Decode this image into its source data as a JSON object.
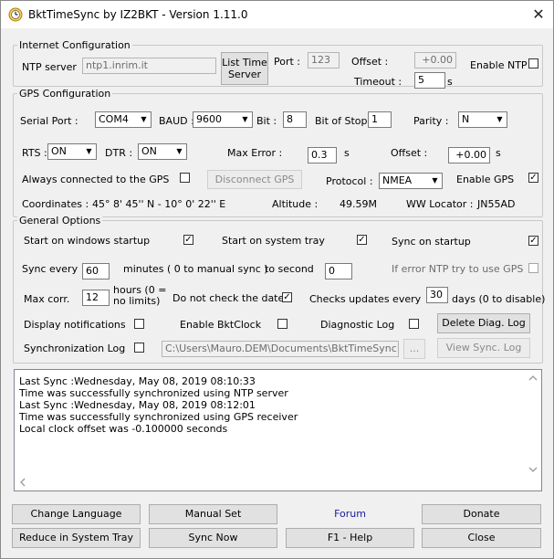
{
  "window": {
    "title": "BktTimeSync by IZ2BKT - Version 1.11.0",
    "close": "✕"
  },
  "internet": {
    "legend": "Internet Configuration",
    "ntp_label": "NTP server",
    "ntp_value": "ntp1.inrim.it",
    "list_btn_line1": "List Time",
    "list_btn_line2": "Server",
    "port_label": "Port :",
    "port_value": "123",
    "offset_label": "Offset :",
    "offset_value": "+0.00",
    "timeout_label": "Timeout :",
    "timeout_value": "5",
    "timeout_unit": "s",
    "enable_ntp_label": "Enable NTP",
    "enable_ntp_checked": false
  },
  "gps": {
    "legend": "GPS Configuration",
    "serial_label": "Serial Port :",
    "serial_value": "COM4",
    "baud_label": "BAUD :",
    "baud_value": "9600",
    "bit_label": "Bit :",
    "bit_value": "8",
    "stop_label": "Bit of Stop",
    "stop_value": "1",
    "parity_label": "Parity :",
    "parity_value": "N",
    "rts_label": "RTS :",
    "rts_value": "ON",
    "dtr_label": "DTR :",
    "dtr_value": "ON",
    "maxerr_label": "Max Error :",
    "maxerr_value": "0.3",
    "maxerr_unit": "s",
    "offset_label": "Offset :",
    "offset_value": "+0.00",
    "offset_unit": "s",
    "always_label": "Always connected to the GPS",
    "always_checked": false,
    "disconnect_btn": "Disconnect GPS",
    "protocol_label": "Protocol :",
    "protocol_value": "NMEA",
    "enable_gps_label": "Enable GPS",
    "enable_gps_checked": true,
    "coord_label": "Coordinates :",
    "coord_value": "45° 8' 45'' N - 10° 0' 22'' E",
    "alt_label": "Altitude :",
    "alt_value": "49.59M",
    "ww_label": "WW Locator :",
    "ww_value": "JN55AD"
  },
  "general": {
    "legend": "General Options",
    "start_windows": "Start on windows startup",
    "start_windows_checked": true,
    "start_tray": "Start on system tray",
    "start_tray_checked": true,
    "sync_startup": "Sync on startup",
    "sync_startup_checked": true,
    "sync_every_label": "Sync every",
    "sync_every_value": "60",
    "minutes_text": "minutes ( 0 to manual sync )",
    "to_second_label": "to second",
    "to_second_value": "0",
    "if_error_label": "If error NTP try to use GPS",
    "if_error_checked": false,
    "maxcorr_label": "Max corr.",
    "maxcorr_value": "12",
    "hours_line1": "hours (0 =",
    "hours_line2": "no limits)",
    "donot_date_label": "Do not check the date",
    "donot_date_checked": true,
    "checks_updates_label": "Checks updates every",
    "checks_updates_value": "30",
    "days_label": "days (0 to disable)",
    "display_notif_label": "Display notifications",
    "display_notif_checked": false,
    "enable_clock_label": "Enable BktClock",
    "enable_clock_checked": false,
    "diag_log_label": "Diagnostic Log",
    "diag_log_checked": false,
    "delete_diag_btn": "Delete Diag. Log",
    "sync_log_label": "Synchronization Log",
    "sync_log_checked": false,
    "log_path": "C:\\Users\\Mauro.DEM\\Documents\\BktTimeSyncLog.txt",
    "browse_btn": "...",
    "view_sync_btn": "View Sync. Log"
  },
  "log": {
    "lines": [
      "Last Sync :Wednesday, May 08, 2019 08:10:33",
      "Time was successfully synchronized using NTP server",
      "Last Sync :Wednesday, May 08, 2019 08:12:01",
      "Time was successfully synchronized using GPS receiver",
      "Local clock offset was -0.100000 seconds"
    ]
  },
  "buttons": {
    "change_language": "Change Language",
    "manual_set": "Manual Set",
    "forum": "Forum",
    "donate": "Donate",
    "reduce_tray": "Reduce in System Tray",
    "sync_now": "Sync Now",
    "help": "F1 - Help",
    "close": "Close"
  },
  "colors": {
    "forum_link": "#1a1a9c",
    "window_bg": "#f0f0f0",
    "button_bg": "#e1e1e1"
  }
}
